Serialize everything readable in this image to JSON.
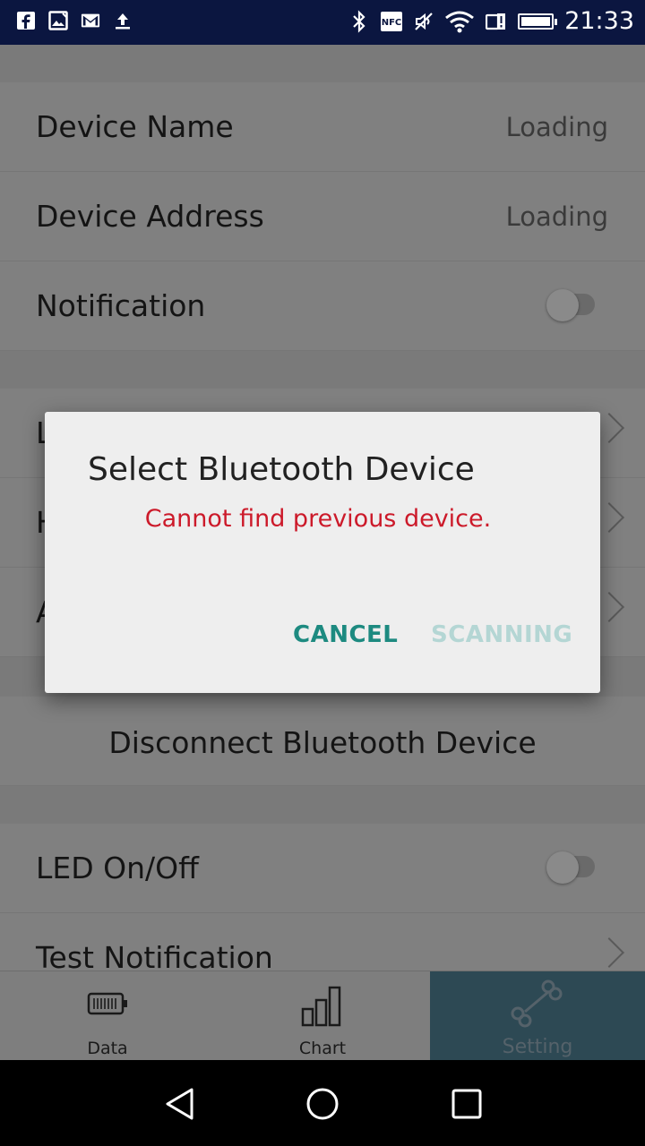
{
  "status_bar": {
    "time": "21:33",
    "left_icons": [
      "facebook-icon",
      "image-icon",
      "gmail-icon",
      "upload-icon"
    ],
    "right_icons": [
      "bluetooth-icon",
      "nfc-icon",
      "mute-icon",
      "wifi-icon",
      "sim-alert-icon",
      "battery-icon"
    ],
    "nfc_label": "NFC"
  },
  "settings": {
    "device_name": {
      "label": "Device Name",
      "value": "Loading"
    },
    "device_address": {
      "label": "Device Address",
      "value": "Loading"
    },
    "notification": {
      "label": "Notification",
      "enabled": false
    },
    "row_l": {
      "label": "L"
    },
    "row_h": {
      "label": "H"
    },
    "row_a": {
      "label": "A"
    },
    "disconnect": {
      "label": "Disconnect Bluetooth Device"
    },
    "led": {
      "label": "LED On/Off",
      "enabled": false
    },
    "test_notification": {
      "label": "Test Notification"
    }
  },
  "tabs": [
    {
      "label": "Data",
      "icon": "battery-icon",
      "active": false
    },
    {
      "label": "Chart",
      "icon": "bar-chart-icon",
      "active": false
    },
    {
      "label": "Setting",
      "icon": "bone-icon",
      "active": true
    }
  ],
  "dialog": {
    "title": "Select Bluetooth Device",
    "message": "Cannot find previous device.",
    "cancel_label": "CANCEL",
    "scanning_label": "SCANNING"
  },
  "colors": {
    "status_bar": "#0b1640",
    "dialog_message": "#cc1a2a",
    "dialog_button": "#1d8a80",
    "dialog_button_disabled": "#b4d6d4",
    "active_tab": "#2d4954"
  }
}
